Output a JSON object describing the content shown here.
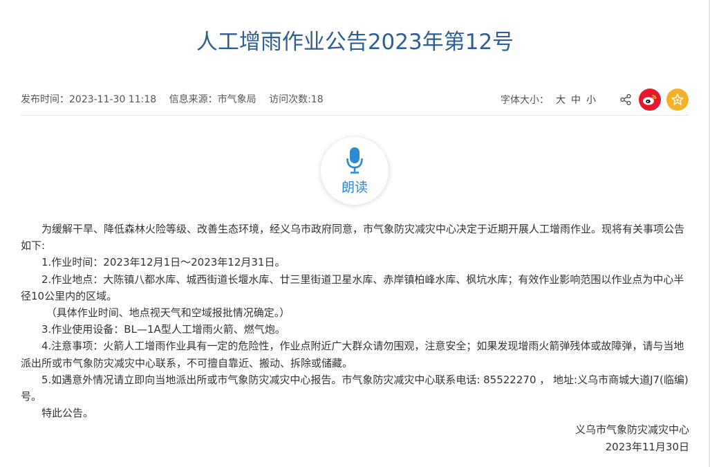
{
  "article": {
    "title": "人工增雨作业公告2023年第12号"
  },
  "meta": {
    "publish_time": "发布时间：2023-11-30 11:18",
    "source": "信息来源：市气象局",
    "visits": "访问次数:18",
    "font_size_label": "字体大小：",
    "font_sizes": [
      "大",
      "中",
      "小"
    ]
  },
  "icons": {
    "share": "share-icon",
    "weibo": "weibo-icon",
    "favorite": "star-icon",
    "microphone": "microphone-icon"
  },
  "colors": {
    "title": "#2e5e94",
    "read_accent": "#2a8ad8",
    "weibo": "#e6162d",
    "favorite": "#f3b12a"
  },
  "read_aloud": {
    "label": "朗读"
  },
  "body": {
    "paragraphs": [
      "为缓解干旱、降低森林火险等级、改善生态环境，经义乌市政府同意，市气象防灾减灾中心决定于近期开展人工增雨作业。现将有关事项公告如下:",
      "1.作业时间：2023年12月1日～2023年12月31日。",
      "2.作业地点：大陈镇八都水库、城西街道长堰水库、廿三里街道卫星水库、赤岸镇柏峰水库、枫坑水库；有效作业影响范围以作业点为中心半径10公里内的区域。",
      "（具体作业时间、地点视天气和空域报批情况确定。）",
      "3.作业使用设备：BL—1A型人工增雨火箭、燃气炮。",
      "4.注意事项：火箭人工增雨作业具有一定的危险性，作业点附近广大群众请勿围观，注意安全；如果发现增雨火箭弹残体或故障弹，请与当地派出所或市气象防灾减灾中心联系，不可擅自靠近、搬动、拆除或储藏。",
      "5.如遇意外情况请立即向当地派出所或市气象防灾减灾中心报告。市气象防灾减灾中心联系电话: 85522270 ， 地址:义乌市商城大道J7(临编)号。",
      "特此公告。"
    ],
    "signature": "义乌市气象防灾减灾中心",
    "date": "2023年11月30日"
  }
}
